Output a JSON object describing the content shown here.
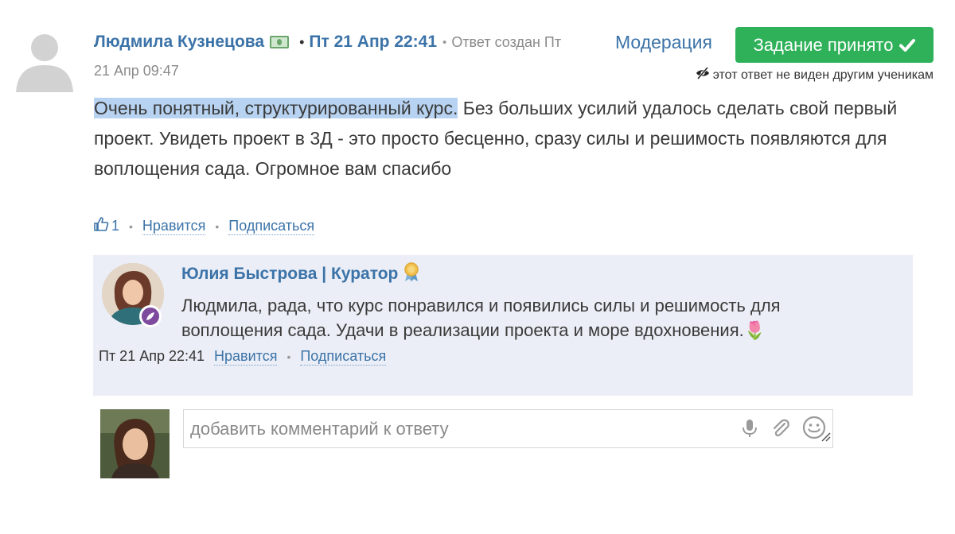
{
  "answer": {
    "author_name": "Людмила Кузнецова",
    "date": "Пт 21 Апр 22:41",
    "created_label": "Ответ создан Пт",
    "created_date": "21 Апр 09:47",
    "moderation_label": "Модерация",
    "accepted_label": "Задание принято",
    "hidden_note": "этот ответ не виден другим ученикам",
    "body_highlighted": "Очень понятный, структурированный курс.",
    "body_rest": " Без больших усилий удалось сделать свой первый проект. Увидеть проект в 3Д - это просто бесценно, сразу силы и решимость появляются для воплощения сада. Огромное вам спасибо",
    "like_count": "1",
    "like_label": "Нравится",
    "subscribe_label": "Подписаться"
  },
  "comment": {
    "author_name": "Юлия Быстрова | Куратор",
    "text": " Людмила, рада, что курс понравился и появились силы и решимость для воплощения сада. Удачи в реализации проекта и море вдохновения.🌷",
    "time": "Пт 21 Апр 22:41",
    "like_label": "Нравится",
    "subscribe_label": "Подписаться"
  },
  "reply": {
    "placeholder": "добавить комментарий к ответу"
  },
  "icons": {
    "money": "money-icon",
    "check": "check-icon",
    "hidden": "eye-off-icon",
    "thumb": "thumbs-up-icon",
    "award": "award-icon",
    "mic": "microphone-icon",
    "clip": "paperclip-icon",
    "smile": "smiley-icon"
  },
  "colors": {
    "link": "#3b73a8",
    "accept": "#2fb15a",
    "highlight": "#b7d3f1",
    "comment_bg": "#ebeef6"
  }
}
